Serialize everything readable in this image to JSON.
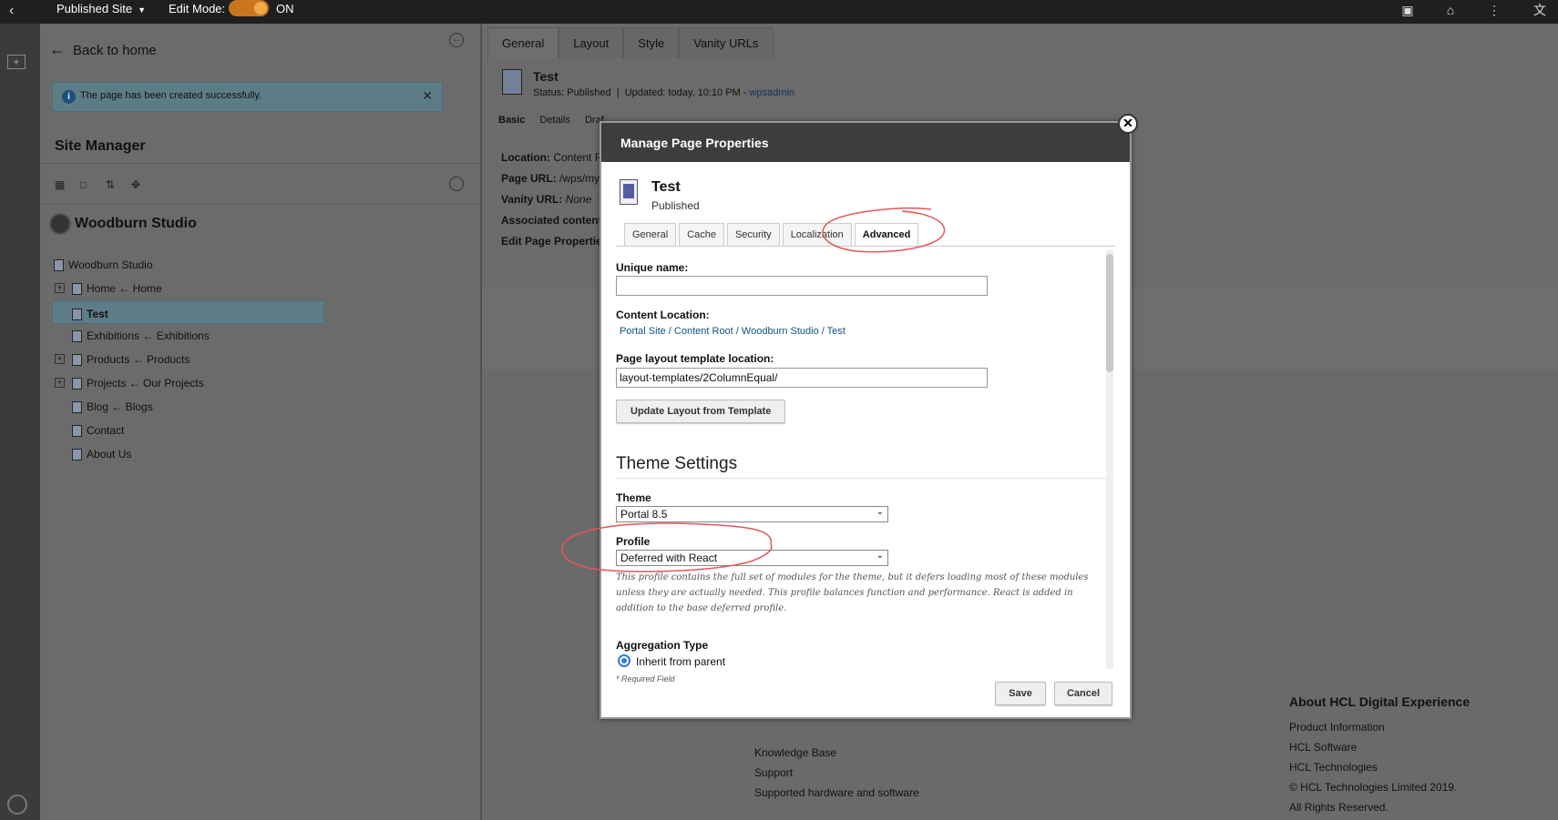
{
  "topbar": {
    "site_label": "Published Site",
    "edit_mode_label": "Edit Mode:",
    "edit_mode_state": "ON",
    "icons": [
      "back-icon",
      "caret-down-icon",
      "panel-icon",
      "home-icon",
      "more-icon",
      "translate-icon"
    ]
  },
  "sidebar": {
    "back_label": "Back to home",
    "notice": "The page has been created successfully.",
    "title": "Site Manager",
    "site_name": "Woodburn Studio",
    "tree": [
      {
        "label": "Woodburn Studio",
        "expander": false,
        "level": 0
      },
      {
        "label": "Home ← Home",
        "expander": true,
        "level": 1
      },
      {
        "label": "Test",
        "expander": false,
        "level": 1,
        "selected": true
      },
      {
        "label": "Exhibitions ← Exhibitions",
        "expander": false,
        "level": 1
      },
      {
        "label": "Products ← Products",
        "expander": true,
        "level": 1
      },
      {
        "label": "Projects ← Our Projects",
        "expander": true,
        "level": 1
      },
      {
        "label": "Blog ← Blogs",
        "expander": false,
        "level": 1
      },
      {
        "label": "Contact",
        "expander": false,
        "level": 1
      },
      {
        "label": "About Us",
        "expander": false,
        "level": 1
      }
    ]
  },
  "main": {
    "tabs": [
      "General",
      "Layout",
      "Style",
      "Vanity URLs"
    ],
    "page_title": "Test",
    "status_text": "Status: Published",
    "updated_text": "Updated: today, 10:10 PM - ",
    "updated_by": "wpsadmin",
    "subtabs": [
      "Basic",
      "Details",
      "Draf"
    ],
    "fields": [
      {
        "label": "Location:",
        "value": "Content F"
      },
      {
        "label": "Page URL:",
        "value": "/wps/my"
      },
      {
        "label": "Vanity URL:",
        "value": "None"
      },
      {
        "label": "Associated content",
        "value": ""
      },
      {
        "label": "Edit Page Propertie",
        "value": ""
      }
    ]
  },
  "footer": {
    "links": [
      "Knowledge Base",
      "Support",
      "Supported hardware and software"
    ],
    "about_title": "About HCL Digital Experience",
    "about_links": [
      "Product Information",
      "HCL Software",
      "HCL Technologies"
    ],
    "copyright": "© HCL Technologies Limited 2019.",
    "rights": "All Rights Reserved."
  },
  "modal": {
    "title": "Manage Page Properties",
    "page_name": "Test",
    "page_status": "Published",
    "tabs": [
      "General",
      "Cache",
      "Security",
      "Localization",
      "Advanced"
    ],
    "active_tab": "Advanced",
    "unique_name_label": "Unique name:",
    "unique_name_value": "",
    "content_location_label": "Content Location:",
    "content_location_path": "Portal Site / Content Root / Woodburn Studio / Test",
    "layout_location_label": "Page layout template location:",
    "layout_location_value": "layout-templates/2ColumnEqual/",
    "update_layout_button": "Update Layout from Template",
    "theme_settings_heading": "Theme Settings",
    "theme_label": "Theme",
    "theme_value": "Portal 8.5",
    "profile_label": "Profile",
    "profile_value": "Deferred with React",
    "profile_description": "This profile contains the full set of modules for the theme, but it defers loading most of these modules unless they are actually needed. This profile balances function and performance. React is added in addition to the base deferred profile.",
    "aggregation_label": "Aggregation Type",
    "aggregation_option": "Inherit from parent",
    "required_note": "* Required Field",
    "save_label": "Save",
    "cancel_label": "Cancel",
    "close_glyph": "✕"
  },
  "annotation_color": "#e0585a"
}
